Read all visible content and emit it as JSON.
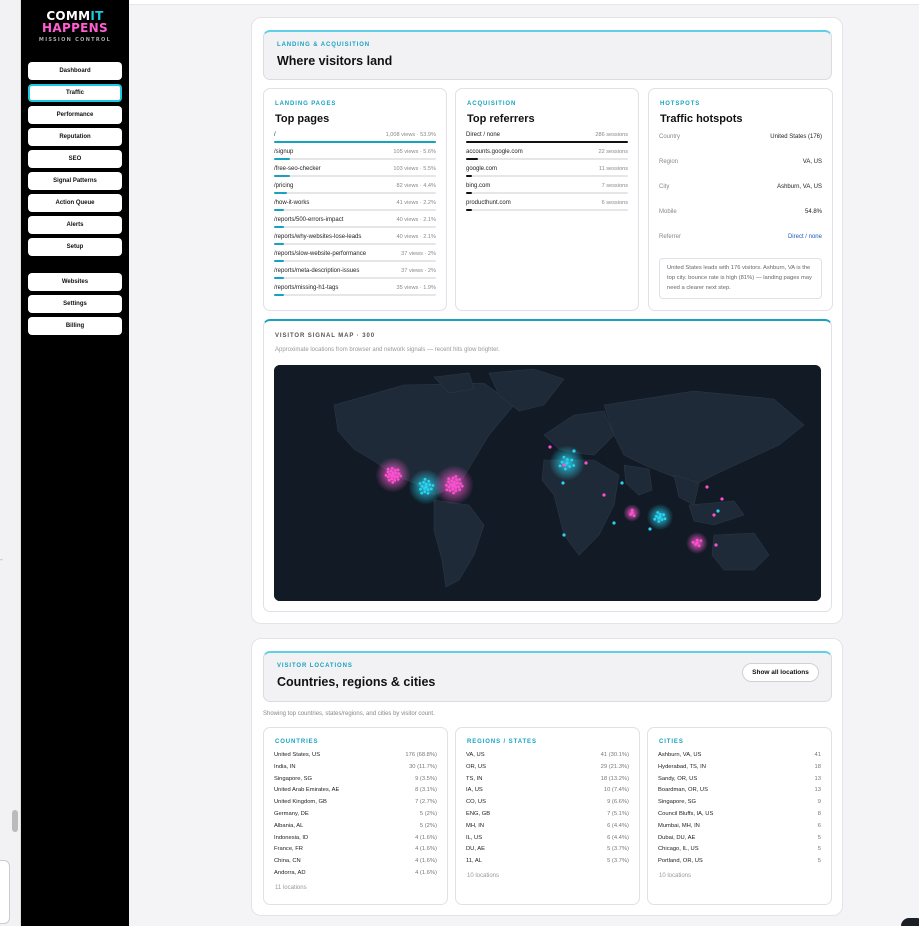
{
  "brand": {
    "line1_a": "COMM",
    "line1_b": "IT",
    "line2": "HAPPENS",
    "tagline": "MISSION CONTROL"
  },
  "nav": {
    "primary": [
      "Dashboard",
      "Traffic",
      "Performance",
      "Reputation",
      "SEO",
      "Signal Patterns",
      "Action Queue",
      "Alerts",
      "Setup"
    ],
    "secondary": [
      "Websites",
      "Settings",
      "Billing"
    ],
    "active": "Traffic"
  },
  "landing": {
    "kicker": "LANDING & ACQUISITION",
    "title": "Where visitors land",
    "pages": {
      "kicker": "LANDING PAGES",
      "title": "Top pages",
      "rows": [
        {
          "path": "/",
          "value": "1,008 views · 53.9%",
          "share": 0.539
        },
        {
          "path": "/signup",
          "value": "105 views · 5.6%",
          "share": 0.056
        },
        {
          "path": "/free-seo-checker",
          "value": "103 views · 5.5%",
          "share": 0.055
        },
        {
          "path": "/pricing",
          "value": "82 views · 4.4%",
          "share": 0.044
        },
        {
          "path": "/how-it-works",
          "value": "41 views · 2.2%",
          "share": 0.022
        },
        {
          "path": "/reports/500-errors-impact",
          "value": "40 views · 2.1%",
          "share": 0.021
        },
        {
          "path": "/reports/why-websites-lose-leads",
          "value": "40 views · 2.1%",
          "share": 0.021
        },
        {
          "path": "/reports/slow-website-performance",
          "value": "37 views · 2%",
          "share": 0.02
        },
        {
          "path": "/reports/meta-description-issues",
          "value": "37 views · 2%",
          "share": 0.02
        },
        {
          "path": "/reports/missing-h1-tags",
          "value": "35 views · 1.9%",
          "share": 0.019
        }
      ]
    },
    "referrers": {
      "kicker": "ACQUISITION",
      "title": "Top referrers",
      "rows": [
        {
          "source": "Direct / none",
          "value": "286 sessions",
          "share": 1.0
        },
        {
          "source": "accounts.google.com",
          "value": "22 sessions",
          "share": 0.077
        },
        {
          "source": "google.com",
          "value": "11 sessions",
          "share": 0.038
        },
        {
          "source": "bing.com",
          "value": "7 sessions",
          "share": 0.024
        },
        {
          "source": "producthunt.com",
          "value": "6 sessions",
          "share": 0.021
        }
      ]
    },
    "hotspots": {
      "kicker": "HOTSPOTS",
      "title": "Traffic hotspots",
      "rows": [
        {
          "key": "Country",
          "value": "United States (176)"
        },
        {
          "key": "Region",
          "value": "VA, US"
        },
        {
          "key": "City",
          "value": "Ashburn, VA, US"
        },
        {
          "key": "Mobile",
          "value": "54.8%"
        },
        {
          "key": "Referrer",
          "value": "Direct / none"
        }
      ],
      "note": "United States leads with 176 visitors. Ashburn, VA is the top city. bounce rate is high (81%) — landing pages may need a clearer next step."
    }
  },
  "map": {
    "kicker": "VISITOR SIGNAL MAP · 300",
    "subtitle": "Approximate locations from browser and network signals — recent hits glow brighter."
  },
  "locations": {
    "kicker": "VISITOR LOCATIONS",
    "title": "Countries, regions & cities",
    "show_all": "Show all locations",
    "caption": "Showing top countries, states/regions, and cities by visitor count.",
    "countries": {
      "kicker": "COUNTRIES",
      "rows": [
        [
          "United States, US",
          "176 (68.8%)"
        ],
        [
          "India, IN",
          "30 (11.7%)"
        ],
        [
          "Singapore, SG",
          "9 (3.5%)"
        ],
        [
          "United Arab Emirates, AE",
          "8 (3.1%)"
        ],
        [
          "United Kingdom, GB",
          "7 (2.7%)"
        ],
        [
          "Germany, DE",
          "5 (2%)"
        ],
        [
          "Albania, AL",
          "5 (2%)"
        ],
        [
          "Indonesia, ID",
          "4 (1.6%)"
        ],
        [
          "France, FR",
          "4 (1.6%)"
        ],
        [
          "China, CN",
          "4 (1.6%)"
        ],
        [
          "Andorra, AD",
          "4 (1.6%)"
        ]
      ],
      "footer": "11 locations"
    },
    "regions": {
      "kicker": "REGIONS / STATES",
      "rows": [
        [
          "VA, US",
          "41 (30.1%)"
        ],
        [
          "OR, US",
          "29 (21.3%)"
        ],
        [
          "TS, IN",
          "18 (13.2%)"
        ],
        [
          "IA, US",
          "10 (7.4%)"
        ],
        [
          "CO, US",
          "9 (6.6%)"
        ],
        [
          "ENG, GB",
          "7 (5.1%)"
        ],
        [
          "MH, IN",
          "6 (4.4%)"
        ],
        [
          "IL, US",
          "6 (4.4%)"
        ],
        [
          "DU, AE",
          "5 (3.7%)"
        ],
        [
          "11, AL",
          "5 (3.7%)"
        ]
      ],
      "footer": "10 locations"
    },
    "cities": {
      "kicker": "CITIES",
      "rows": [
        [
          "Ashburn, VA, US",
          "41"
        ],
        [
          "Hyderabad, TS, IN",
          "18"
        ],
        [
          "Sandy, OR, US",
          "13"
        ],
        [
          "Boardman, OR, US",
          "13"
        ],
        [
          "Singapore, SG",
          "9"
        ],
        [
          "Council Bluffs, IA, US",
          "8"
        ],
        [
          "Mumbai, MH, IN",
          "6"
        ],
        [
          "Dubai, DU, AE",
          "5"
        ],
        [
          "Chicago, IL, US",
          "5"
        ],
        [
          "Portland, OR, US",
          "5"
        ]
      ],
      "footer": "10 locations"
    }
  },
  "colors": {
    "accent": "#16a3c2",
    "pink": "#ff4fd0",
    "cyan": "#2ad3ef",
    "map_bg": "#111a25",
    "land": "#1f2a38"
  }
}
